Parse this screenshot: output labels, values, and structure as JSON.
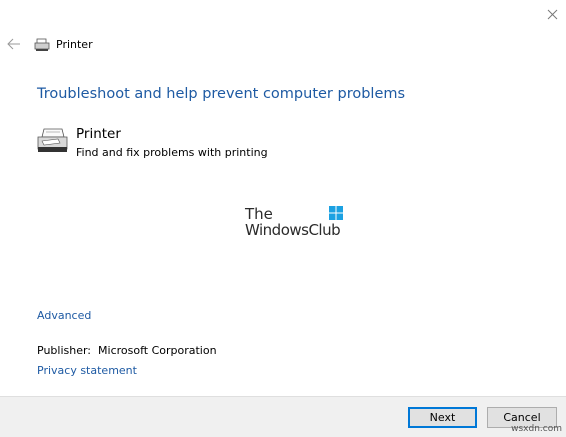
{
  "window": {
    "title": "Printer"
  },
  "main": {
    "heading": "Troubleshoot and help prevent computer problems",
    "item": {
      "title": "Printer",
      "description": "Find and fix problems with printing",
      "icon": "printer-icon"
    },
    "watermark": {
      "line1": "The",
      "line2": "WindowsClub"
    },
    "advanced_link": "Advanced",
    "publisher_label": "Publisher:",
    "publisher_value": "Microsoft Corporation",
    "privacy_link": "Privacy statement"
  },
  "footer": {
    "next_label": "Next",
    "cancel_label": "Cancel"
  },
  "site_watermark": "wsxdn.com",
  "colors": {
    "link": "#1e5aa3",
    "footer_bg": "#f0f0f0",
    "focus_border": "#0078d7"
  }
}
